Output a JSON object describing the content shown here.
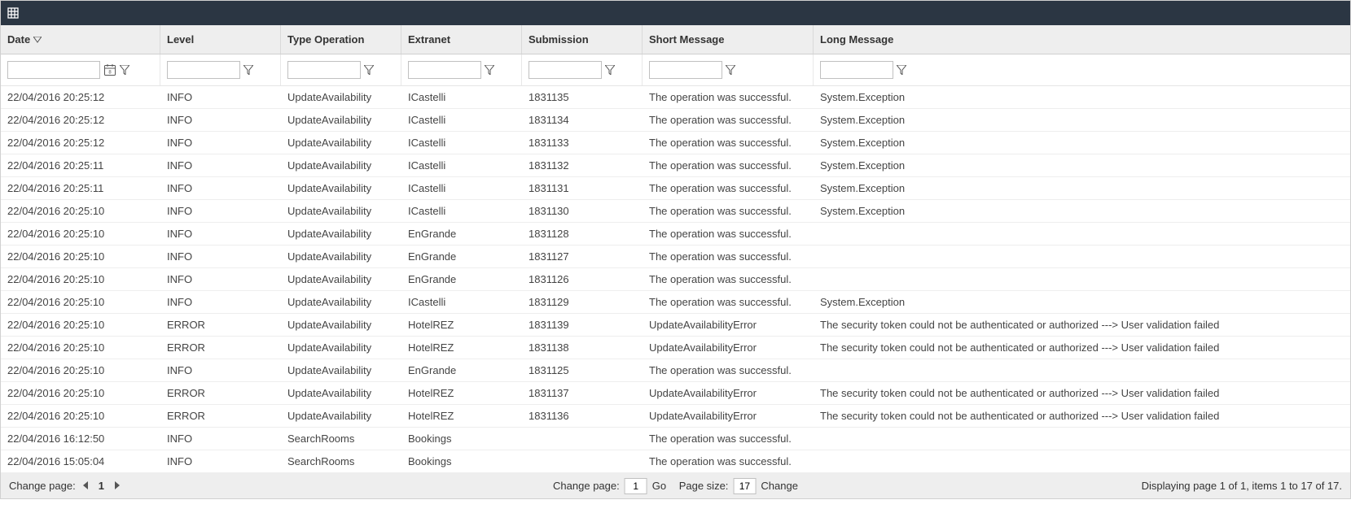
{
  "columns": {
    "date": "Date",
    "level": "Level",
    "type": "Type Operation",
    "extranet": "Extranet",
    "submission": "Submission",
    "short": "Short Message",
    "long": "Long Message"
  },
  "filters": {
    "date": "",
    "level": "",
    "type": "",
    "extranet": "",
    "submission": "",
    "short": "",
    "long": ""
  },
  "rows": [
    {
      "date": "22/04/2016 20:25:12",
      "level": "INFO",
      "type": "UpdateAvailability",
      "extranet": "ICastelli",
      "submission": "1831135",
      "short": "The operation was successful.",
      "long": "System.Exception"
    },
    {
      "date": "22/04/2016 20:25:12",
      "level": "INFO",
      "type": "UpdateAvailability",
      "extranet": "ICastelli",
      "submission": "1831134",
      "short": "The operation was successful.",
      "long": "System.Exception"
    },
    {
      "date": "22/04/2016 20:25:12",
      "level": "INFO",
      "type": "UpdateAvailability",
      "extranet": "ICastelli",
      "submission": "1831133",
      "short": "The operation was successful.",
      "long": "System.Exception"
    },
    {
      "date": "22/04/2016 20:25:11",
      "level": "INFO",
      "type": "UpdateAvailability",
      "extranet": "ICastelli",
      "submission": "1831132",
      "short": "The operation was successful.",
      "long": "System.Exception"
    },
    {
      "date": "22/04/2016 20:25:11",
      "level": "INFO",
      "type": "UpdateAvailability",
      "extranet": "ICastelli",
      "submission": "1831131",
      "short": "The operation was successful.",
      "long": "System.Exception"
    },
    {
      "date": "22/04/2016 20:25:10",
      "level": "INFO",
      "type": "UpdateAvailability",
      "extranet": "ICastelli",
      "submission": "1831130",
      "short": "The operation was successful.",
      "long": "System.Exception"
    },
    {
      "date": "22/04/2016 20:25:10",
      "level": "INFO",
      "type": "UpdateAvailability",
      "extranet": "EnGrande",
      "submission": "1831128",
      "short": "The operation was successful.",
      "long": ""
    },
    {
      "date": "22/04/2016 20:25:10",
      "level": "INFO",
      "type": "UpdateAvailability",
      "extranet": "EnGrande",
      "submission": "1831127",
      "short": "The operation was successful.",
      "long": ""
    },
    {
      "date": "22/04/2016 20:25:10",
      "level": "INFO",
      "type": "UpdateAvailability",
      "extranet": "EnGrande",
      "submission": "1831126",
      "short": "The operation was successful.",
      "long": ""
    },
    {
      "date": "22/04/2016 20:25:10",
      "level": "INFO",
      "type": "UpdateAvailability",
      "extranet": "ICastelli",
      "submission": "1831129",
      "short": "The operation was successful.",
      "long": "System.Exception"
    },
    {
      "date": "22/04/2016 20:25:10",
      "level": "ERROR",
      "type": "UpdateAvailability",
      "extranet": "HotelREZ",
      "submission": "1831139",
      "short": "UpdateAvailabilityError",
      "long": "The security token could not be authenticated or authorized ---> User validation failed"
    },
    {
      "date": "22/04/2016 20:25:10",
      "level": "ERROR",
      "type": "UpdateAvailability",
      "extranet": "HotelREZ",
      "submission": "1831138",
      "short": "UpdateAvailabilityError",
      "long": "The security token could not be authenticated or authorized ---> User validation failed"
    },
    {
      "date": "22/04/2016 20:25:10",
      "level": "INFO",
      "type": "UpdateAvailability",
      "extranet": "EnGrande",
      "submission": "1831125",
      "short": "The operation was successful.",
      "long": ""
    },
    {
      "date": "22/04/2016 20:25:10",
      "level": "ERROR",
      "type": "UpdateAvailability",
      "extranet": "HotelREZ",
      "submission": "1831137",
      "short": "UpdateAvailabilityError",
      "long": "The security token could not be authenticated or authorized ---> User validation failed"
    },
    {
      "date": "22/04/2016 20:25:10",
      "level": "ERROR",
      "type": "UpdateAvailability",
      "extranet": "HotelREZ",
      "submission": "1831136",
      "short": "UpdateAvailabilityError",
      "long": "The security token could not be authenticated or authorized ---> User validation failed"
    },
    {
      "date": "22/04/2016 16:12:50",
      "level": "INFO",
      "type": "SearchRooms",
      "extranet": "Bookings",
      "submission": "",
      "short": "The operation was successful.",
      "long": ""
    },
    {
      "date": "22/04/2016 15:05:04",
      "level": "INFO",
      "type": "SearchRooms",
      "extranet": "Bookings",
      "submission": "",
      "short": "The operation was successful.",
      "long": ""
    }
  ],
  "footer": {
    "change_page_label": "Change page:",
    "current_page": "1",
    "center_change_page_label": "Change page:",
    "page_input": "1",
    "go_label": "Go",
    "page_size_label": "Page size:",
    "page_size_input": "17",
    "change_label": "Change",
    "status": "Displaying page 1 of 1, items 1 to 17 of 17."
  }
}
